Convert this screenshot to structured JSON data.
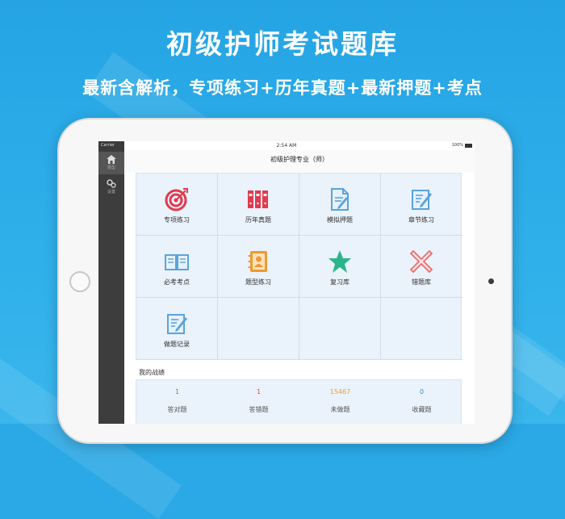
{
  "banner": {
    "headline": "初级护师考试题库",
    "subline": "最新含解析，专项练习+历年真题+最新押题+考点"
  },
  "status_bar": {
    "carrier": "Carrier",
    "time": "2:54 AM",
    "battery": "100%"
  },
  "nav": {
    "title": "初级护理专业（师）"
  },
  "sidebar": {
    "items": [
      {
        "label": "题型",
        "icon": "home-icon",
        "active": true
      },
      {
        "label": "设置",
        "icon": "gears-icon",
        "active": false
      }
    ]
  },
  "menu": [
    {
      "label": "专项练习",
      "icon": "target-icon"
    },
    {
      "label": "历年真题",
      "icon": "binders-icon"
    },
    {
      "label": "模拟押题",
      "icon": "document-edit-icon"
    },
    {
      "label": "章节练习",
      "icon": "notepad-pen-icon"
    },
    {
      "label": "必考考点",
      "icon": "open-book-icon"
    },
    {
      "label": "题型练习",
      "icon": "contact-book-icon"
    },
    {
      "label": "复习库",
      "icon": "star-icon"
    },
    {
      "label": "错题库",
      "icon": "cross-icon"
    },
    {
      "label": "做题记录",
      "icon": "record-icon"
    }
  ],
  "record": {
    "title": "我的战绩",
    "stats": [
      {
        "value": "1",
        "label": "答对题",
        "color": "#3a8fd6"
      },
      {
        "value": "1",
        "label": "答错题",
        "color": "#e0533e"
      },
      {
        "value": "15467",
        "label": "未做题",
        "color": "#f0a020"
      },
      {
        "value": "0",
        "label": "收藏题",
        "color": "#3a8fd6"
      }
    ]
  },
  "colors": {
    "background": "#2aa9e6",
    "icon_blue": "#5aa3dc",
    "icon_red": "#e23a4e",
    "icon_green": "#2bb58a",
    "icon_orange": "#ef9a2e"
  }
}
